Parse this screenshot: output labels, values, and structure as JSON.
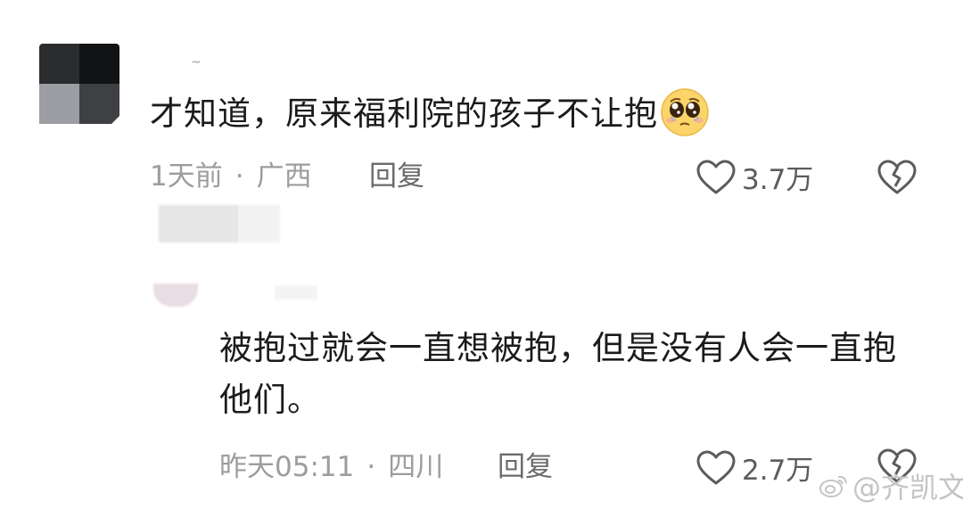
{
  "comment1": {
    "username": "~",
    "text": "才知道，原来福利院的孩子不让抱",
    "emoji": "pleading-face-emoji",
    "time": "1天前",
    "location": "广西",
    "reply_label": "回复",
    "likes": "3.7万"
  },
  "reply1": {
    "text": "被抱过就会一直想被抱，但是没有人会一直抱他们。",
    "time": "昨天05:11",
    "location": "四川",
    "reply_label": "回复",
    "likes": "2.7万"
  },
  "separator_dot": "·",
  "watermark": {
    "text": "@齐凯文",
    "icon": "weibo-icon"
  },
  "colors": {
    "text_primary": "#1b1b1b",
    "text_meta": "#9d9d9d",
    "icon_gray": "#5c5c5c"
  }
}
